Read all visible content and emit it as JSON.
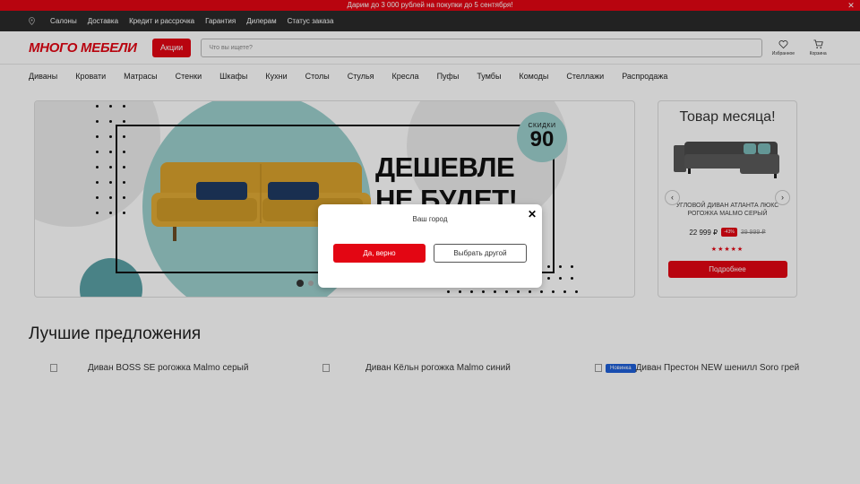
{
  "promo": {
    "text": "Дарим до 3 000 рублей на покупки до 5 сентября!",
    "close_icon": "close-icon"
  },
  "topnav": {
    "items": [
      "Салоны",
      "Доставка",
      "Кредит и рассрочка",
      "Гарантия",
      "Дилерам",
      "Статус заказа"
    ],
    "location_icon": "location-pin-icon"
  },
  "header": {
    "logo": "МНОГО МЕБЕЛИ",
    "promo_button": "Акции",
    "search_placeholder": "Что вы ищете?",
    "favorites_label": "Избранное",
    "cart_label": "Корзина"
  },
  "categories": [
    "Диваны",
    "Кровати",
    "Матрасы",
    "Стенки",
    "Шкафы",
    "Кухни",
    "Столы",
    "Стулья",
    "Кресла",
    "Пуфы",
    "Тумбы",
    "Комоды",
    "Стеллажи",
    "Распродажа"
  ],
  "hero": {
    "headline_line1": "ДЕШЕВЛЕ",
    "headline_line2": "НЕ БУДЕТ!",
    "badge_label": "СКИДКИ",
    "badge_value": "90",
    "slides": 2,
    "active_slide": 1
  },
  "product_of_month": {
    "title": "Товар месяца!",
    "name": "УГЛОВОЙ ДИВАН АТЛАНТА ЛЮКС РОГОЖКА MALMO СЕРЫЙ",
    "price": "22 999 ₽",
    "discount": "-43%",
    "old_price": "39 999 ₽",
    "rating": 5,
    "stars": "★★★★★",
    "button": "Подробнее"
  },
  "best": {
    "title": "Лучшие предложения",
    "products": [
      {
        "name": "Диван BOSS SE рогожка Malmo серый",
        "tag": ""
      },
      {
        "name": "Диван Кёльн рогожка Malmo синий",
        "tag": ""
      },
      {
        "name": "Диван Престон NEW шенилл Soro грей",
        "tag": "Новинка"
      }
    ]
  },
  "modal": {
    "title": "Ваш город",
    "confirm": "Да, верно",
    "other": "Выбрать другой"
  },
  "colors": {
    "brand_red": "#e30613",
    "dark_bar": "#2b2b2b",
    "teal": "#9ccfcd",
    "new_tag": "#1e5fd8"
  }
}
